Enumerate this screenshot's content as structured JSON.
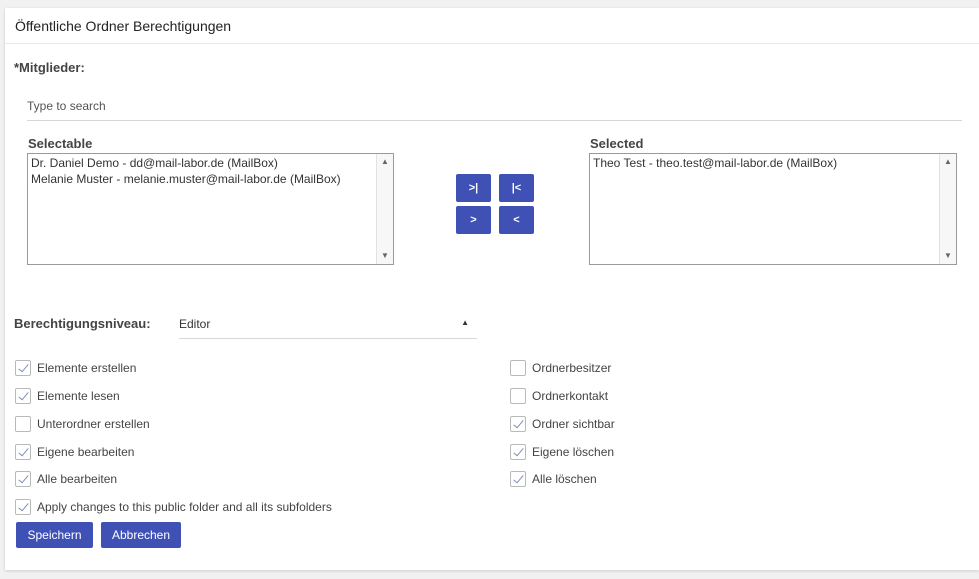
{
  "dialog": {
    "title": "Öffentliche Ordner Berechtigungen"
  },
  "members": {
    "label": "*Mitglieder:",
    "search_placeholder": "Type to search",
    "selectable_title": "Selectable",
    "selected_title": "Selected",
    "selectable_items": [
      "Dr. Daniel Demo - dd@mail-labor.de (MailBox)",
      "Melanie Muster - melanie.muster@mail-labor.de (MailBox)"
    ],
    "selected_items": [
      "Theo Test - theo.test@mail-labor.de (MailBox)"
    ],
    "buttons": {
      "move_all_right": ">|",
      "move_all_left": "|<",
      "move_right": ">",
      "move_left": "<"
    }
  },
  "permission_level": {
    "label": "Berechtigungsniveau:",
    "value": "Editor"
  },
  "permissions_left": [
    {
      "label": "Elemente erstellen",
      "checked": true
    },
    {
      "label": "Elemente lesen",
      "checked": true
    },
    {
      "label": "Unterordner erstellen",
      "checked": false
    },
    {
      "label": "Eigene bearbeiten",
      "checked": true
    },
    {
      "label": "Alle bearbeiten",
      "checked": true
    }
  ],
  "permissions_right": [
    {
      "label": "Ordnerbesitzer",
      "checked": false
    },
    {
      "label": "Ordnerkontakt",
      "checked": false
    },
    {
      "label": "Ordner sichtbar",
      "checked": true
    },
    {
      "label": "Eigene löschen",
      "checked": true
    },
    {
      "label": "Alle löschen",
      "checked": true
    }
  ],
  "apply_subfolders": {
    "label": "Apply changes to this public folder and all its subfolders",
    "checked": true
  },
  "actions": {
    "save": "Speichern",
    "cancel": "Abbrechen"
  },
  "colors": {
    "primary": "#3f51b5",
    "check": "#7d90b8"
  }
}
